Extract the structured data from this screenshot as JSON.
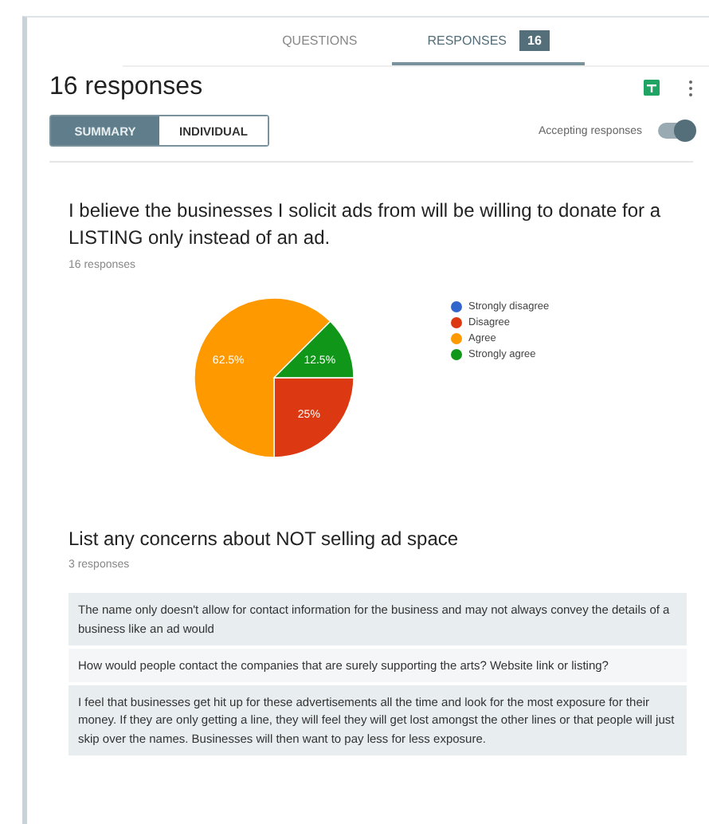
{
  "tabs": [
    {
      "label": "QUESTIONS",
      "selected": false
    },
    {
      "label": "RESPONSES",
      "selected": true,
      "badge": "16"
    }
  ],
  "header": {
    "title": "16 responses",
    "view_toggle": [
      {
        "label": "SUMMARY",
        "selected": true
      },
      {
        "label": "INDIVIDUAL",
        "selected": false
      }
    ],
    "accepting_label": "Accepting responses",
    "accepting_on": true
  },
  "questions": [
    {
      "kind": "chart",
      "title": "I believe the businesses I solicit ads from will be willing to donate for a LISTING only instead of an ad.",
      "count": "16 responses",
      "chart_data": {
        "type": "pie",
        "categories": [
          "Strongly disagree",
          "Disagree",
          "Agree",
          "Strongly agree"
        ],
        "values": [
          0,
          25,
          62.5,
          12.5
        ],
        "colors": [
          "#3366cc",
          "#dc3912",
          "#ff9900",
          "#109618"
        ],
        "value_labels": [
          null,
          "25%",
          "62.5%",
          "12.5%"
        ]
      }
    },
    {
      "kind": "text",
      "title": "List any concerns about NOT selling ad space",
      "count": "3 responses",
      "answers": [
        "The name only doesn't allow for contact information for the business and may not always convey the details of a business like an ad would",
        "How would people contact the companies that are surely supporting the arts? Website link or listing?",
        "I feel that businesses get hit up for these advertisements all the time and look for the most exposure for their money. If they are only getting a line, they will feel they will get lost amongst the other lines or that people will just skip over the names. Businesses will then want to pay less for less exposure."
      ]
    }
  ]
}
